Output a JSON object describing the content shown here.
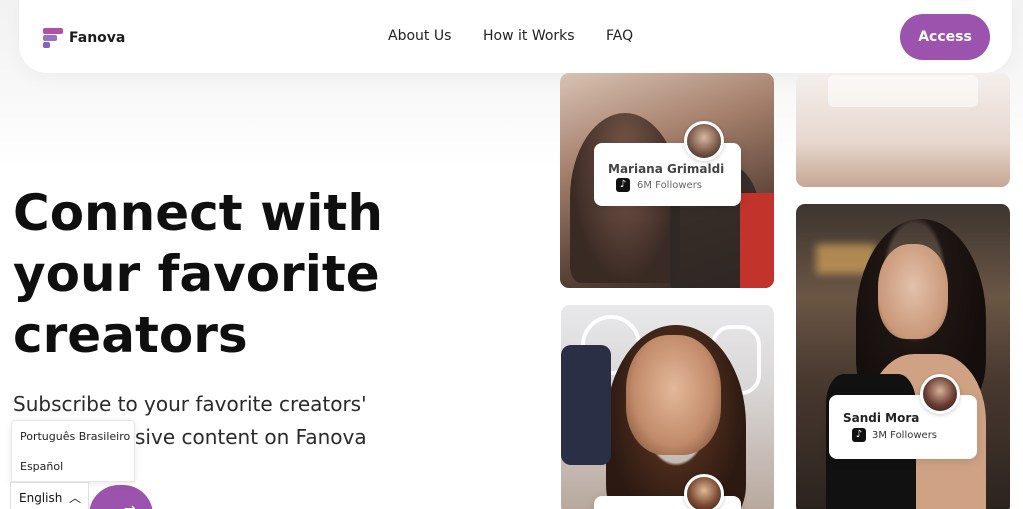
{
  "nav": {
    "brand": "Fanova",
    "links": [
      "About Us",
      "How it Works",
      "FAQ"
    ],
    "access_label": "Access"
  },
  "hero": {
    "title_lines": [
      "Connect with",
      "your favorite",
      "creators"
    ],
    "subtitle_line1": "Subscribe to your favorite creators'",
    "subtitle_line2_visible": "sive content on Fanova"
  },
  "language": {
    "options": [
      "Português Brasileiro",
      "Español"
    ],
    "current": "English"
  },
  "creators": [
    {
      "name": "Mariana Grimaldi",
      "followers": "6M Followers",
      "platform": "tiktok-icon"
    },
    {
      "name": "Sandi Mora",
      "followers": "3M Followers",
      "platform": "tiktok-icon"
    }
  ],
  "colors": {
    "accent": "#9b53ad",
    "text": "#0f0f0f"
  }
}
